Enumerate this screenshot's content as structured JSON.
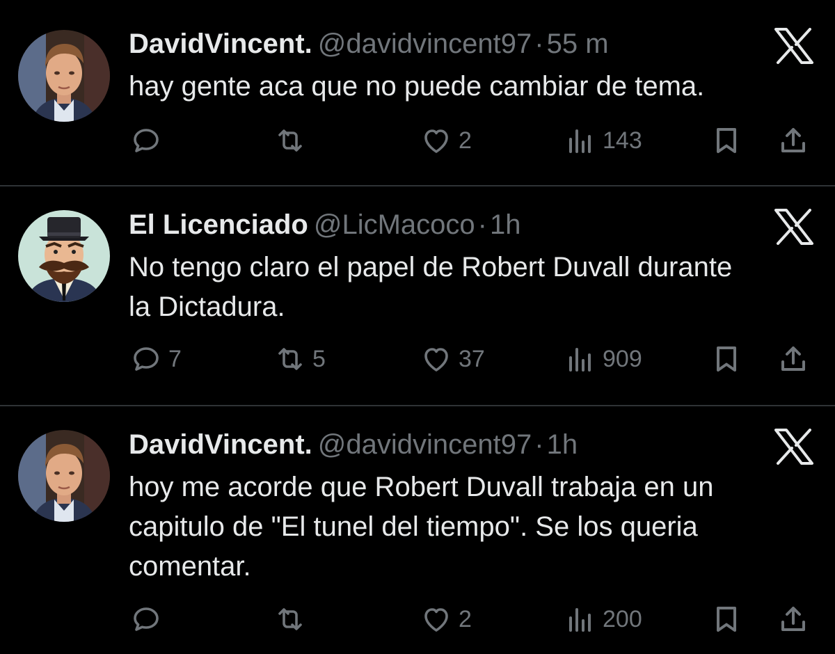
{
  "tweets": [
    {
      "name": "DavidVincent.",
      "handle": "@davidvincent97",
      "sep": "·",
      "time": "55 m",
      "text": "hay gente aca que no puede cambiar de tema.",
      "replies": "",
      "reposts": "",
      "likes": "2",
      "views": "143",
      "avatar_icon": "man-portrait-avatar"
    },
    {
      "name": "El Licenciado",
      "handle": "@LicMacoco",
      "sep": "·",
      "time": "1h",
      "text": "No tengo claro el papel de Robert Duvall durante\nla Dictadura.",
      "replies": "7",
      "reposts": "5",
      "likes": "37",
      "views": "909",
      "avatar_icon": "mustached-man-cartoon-avatar"
    },
    {
      "name": "DavidVincent.",
      "handle": "@davidvincent97",
      "sep": "·",
      "time": "1h",
      "text": "hoy me acorde que Robert Duvall trabaja en un\ncapitulo de \"El tunel del tiempo\".   Se los queria\ncomentar.",
      "replies": "",
      "reposts": "",
      "likes": "2",
      "views": "200",
      "avatar_icon": "man-portrait-avatar"
    }
  ],
  "colors": {
    "background": "#000000",
    "text": "#e7e9ea",
    "muted": "#71767b",
    "divider": "#2f3336"
  },
  "icons": [
    "reply-icon",
    "repost-icon",
    "like-icon",
    "views-icon",
    "bookmark-icon",
    "share-icon",
    "x-logo-icon"
  ]
}
